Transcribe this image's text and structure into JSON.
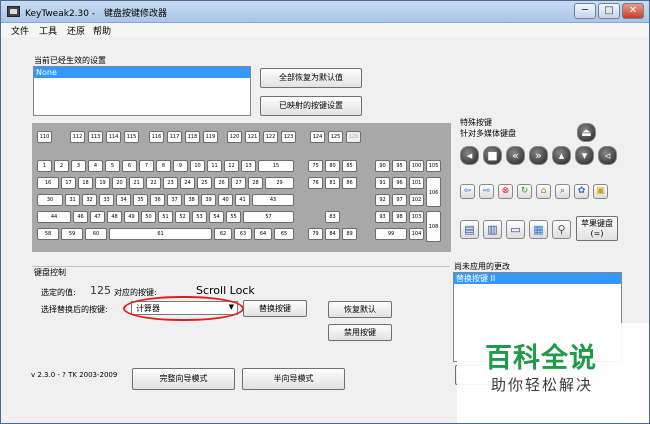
{
  "window": {
    "app_title": "KeyTweak2.30 -",
    "subtitle": "键盘按键修改器",
    "minimize": "─",
    "maximize": "□",
    "close": "✕"
  },
  "menu": [
    "文件",
    "工具",
    "还原",
    "帮助"
  ],
  "current_settings": {
    "label": "当前已经生效的设置",
    "items": [
      "None"
    ],
    "restore_all_button": "全部恢复为默认值",
    "mapped_keys_button": "已映射的按键设置"
  },
  "keyboard": {
    "fn_row": [
      "110",
      "112",
      "113",
      "114",
      "115",
      "116",
      "117",
      "118",
      "119",
      "120",
      "121",
      "122",
      "123",
      "124",
      "125",
      "126"
    ],
    "row1": [
      "1",
      "2",
      "3",
      "4",
      "5",
      "6",
      "7",
      "8",
      "9",
      "10",
      "11",
      "12",
      "13",
      "15"
    ],
    "row2": [
      "16",
      "17",
      "18",
      "19",
      "20",
      "21",
      "22",
      "23",
      "24",
      "25",
      "26",
      "27",
      "28",
      "29"
    ],
    "row3": [
      "30",
      "31",
      "32",
      "33",
      "34",
      "35",
      "36",
      "37",
      "38",
      "39",
      "40",
      "41",
      "43"
    ],
    "row4": [
      "44",
      "46",
      "47",
      "48",
      "49",
      "50",
      "51",
      "52",
      "53",
      "54",
      "55",
      "57"
    ],
    "row5": [
      "58",
      "59",
      "60",
      "61",
      "62",
      "63",
      "64",
      "65"
    ],
    "nav": [
      "75",
      "80",
      "85",
      "76",
      "81",
      "86",
      "83",
      "79",
      "84",
      "89"
    ],
    "numpad": [
      "90",
      "95",
      "100",
      "105",
      "91",
      "96",
      "101",
      "106",
      "92",
      "97",
      "102",
      "93",
      "98",
      "103",
      "108",
      "99",
      "104"
    ]
  },
  "special_keys": {
    "label1": "特殊按键",
    "label2": "针对多媒体键盘",
    "apple_button": "苹果键盘",
    "apple_sub": "(=)"
  },
  "key_control": {
    "section_label": "键盘控制",
    "selected_label": "选定的值:",
    "selected_value": "125",
    "mapped_label": "对应的按键:",
    "mapped_value": "Scroll Lock",
    "replace_label": "选择替换后的按键:",
    "replace_value": "计算器",
    "swap_button": "替换按键",
    "restore_default_button": "恢复默认",
    "disable_button": "禁用按键"
  },
  "pending": {
    "label": "尚未应用的更改",
    "items": [
      "替换按键 II"
    ]
  },
  "footer": {
    "version": "v 2.3.0 - ? TK 2003-2009",
    "full_mode_button": "完整向导模式",
    "half_mode_button": "半向导模式"
  },
  "watermark": {
    "title": "百科全说",
    "subtitle": "助你轻松解决"
  }
}
